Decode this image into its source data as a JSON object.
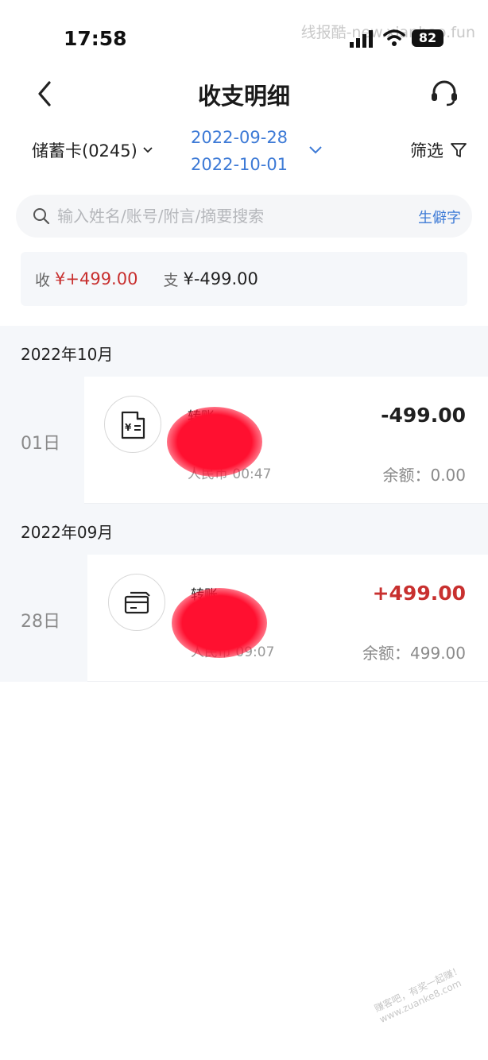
{
  "status_bar": {
    "time": "17:58",
    "watermark": "线报酷-new.xianbao.fun",
    "battery": "82"
  },
  "nav": {
    "title": "收支明细"
  },
  "filter": {
    "card": "储蓄卡(0245)",
    "date_start": "2022-09-28",
    "date_end": "2022-10-01",
    "filter_label": "筛选"
  },
  "search": {
    "placeholder": "输入姓名/账号/附言/摘要搜索",
    "rare_char_label": "生僻字"
  },
  "summary": {
    "income_label": "收",
    "income_value": "¥+499.00",
    "expense_label": "支",
    "expense_value": "¥-499.00"
  },
  "months": [
    {
      "label": "2022年10月",
      "transactions": [
        {
          "day": "01日",
          "type": "转账",
          "amount": "-499.00",
          "meta": "人民币 00:47",
          "balance": "余额：0.00",
          "icon": "receipt-yuan-icon"
        }
      ]
    },
    {
      "label": "2022年09月",
      "transactions": [
        {
          "day": "28日",
          "type": "转账",
          "amount": "+499.00",
          "meta": "人民币 09:07",
          "balance": "余额：499.00",
          "icon": "card-transfer-icon"
        }
      ]
    }
  ],
  "colors": {
    "accent_blue": "#3d7ad6",
    "income_red": "#c8302f"
  },
  "footer_watermark": "赚客吧，有奖一起赚！ www.zuanke8.com"
}
